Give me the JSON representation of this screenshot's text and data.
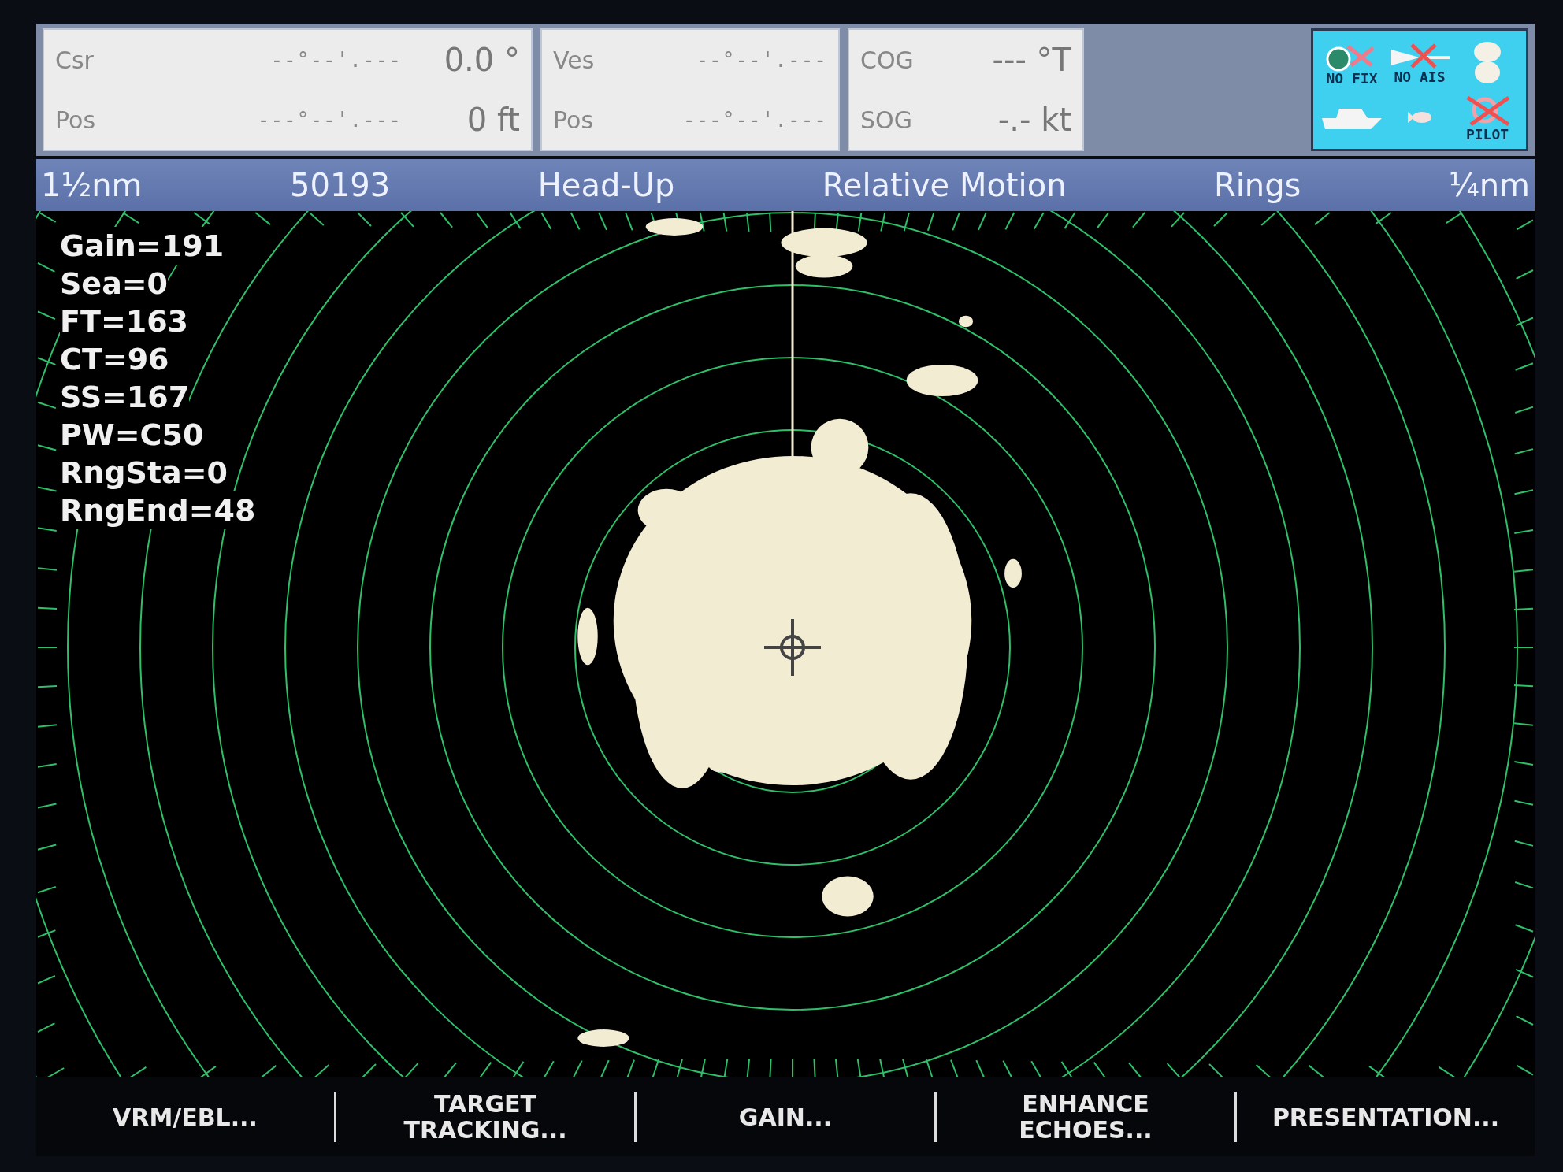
{
  "data_panels": [
    {
      "rows": [
        {
          "label": "Csr",
          "position": "--°--'.---",
          "value": "0.0 °"
        },
        {
          "label": "Pos",
          "position": "---°--'.---",
          "value": "0 ft"
        }
      ]
    },
    {
      "rows": [
        {
          "label": "Ves",
          "position": "--°--'.---",
          "value": ""
        },
        {
          "label": "Pos",
          "position": "---°--'.---",
          "value": ""
        }
      ]
    },
    {
      "rows": [
        {
          "label": "COG",
          "position": "",
          "value": "--- °T"
        },
        {
          "label": "SOG",
          "position": "",
          "value": "-.- kt"
        }
      ]
    }
  ],
  "status_icons": [
    {
      "kind": "fix",
      "label": "NO FIX"
    },
    {
      "kind": "ais",
      "label": "NO AIS"
    },
    {
      "kind": "pilot",
      "label": "PILOT"
    }
  ],
  "status_bar": [
    "1½nm",
    "50193",
    "Head-Up",
    "Relative Motion",
    "Rings",
    "¼nm"
  ],
  "readouts": [
    "Gain=191",
    "Sea=0",
    "FT=163",
    "CT=96",
    "SS=167",
    "PW=C50",
    "RngSta=0",
    "RngEnd=48"
  ],
  "softkeys": [
    "VRM/EBL...",
    "TARGET\nTRACKING...",
    "GAIN...",
    "ENHANCE\nECHOES...",
    "PRESENTATION..."
  ]
}
